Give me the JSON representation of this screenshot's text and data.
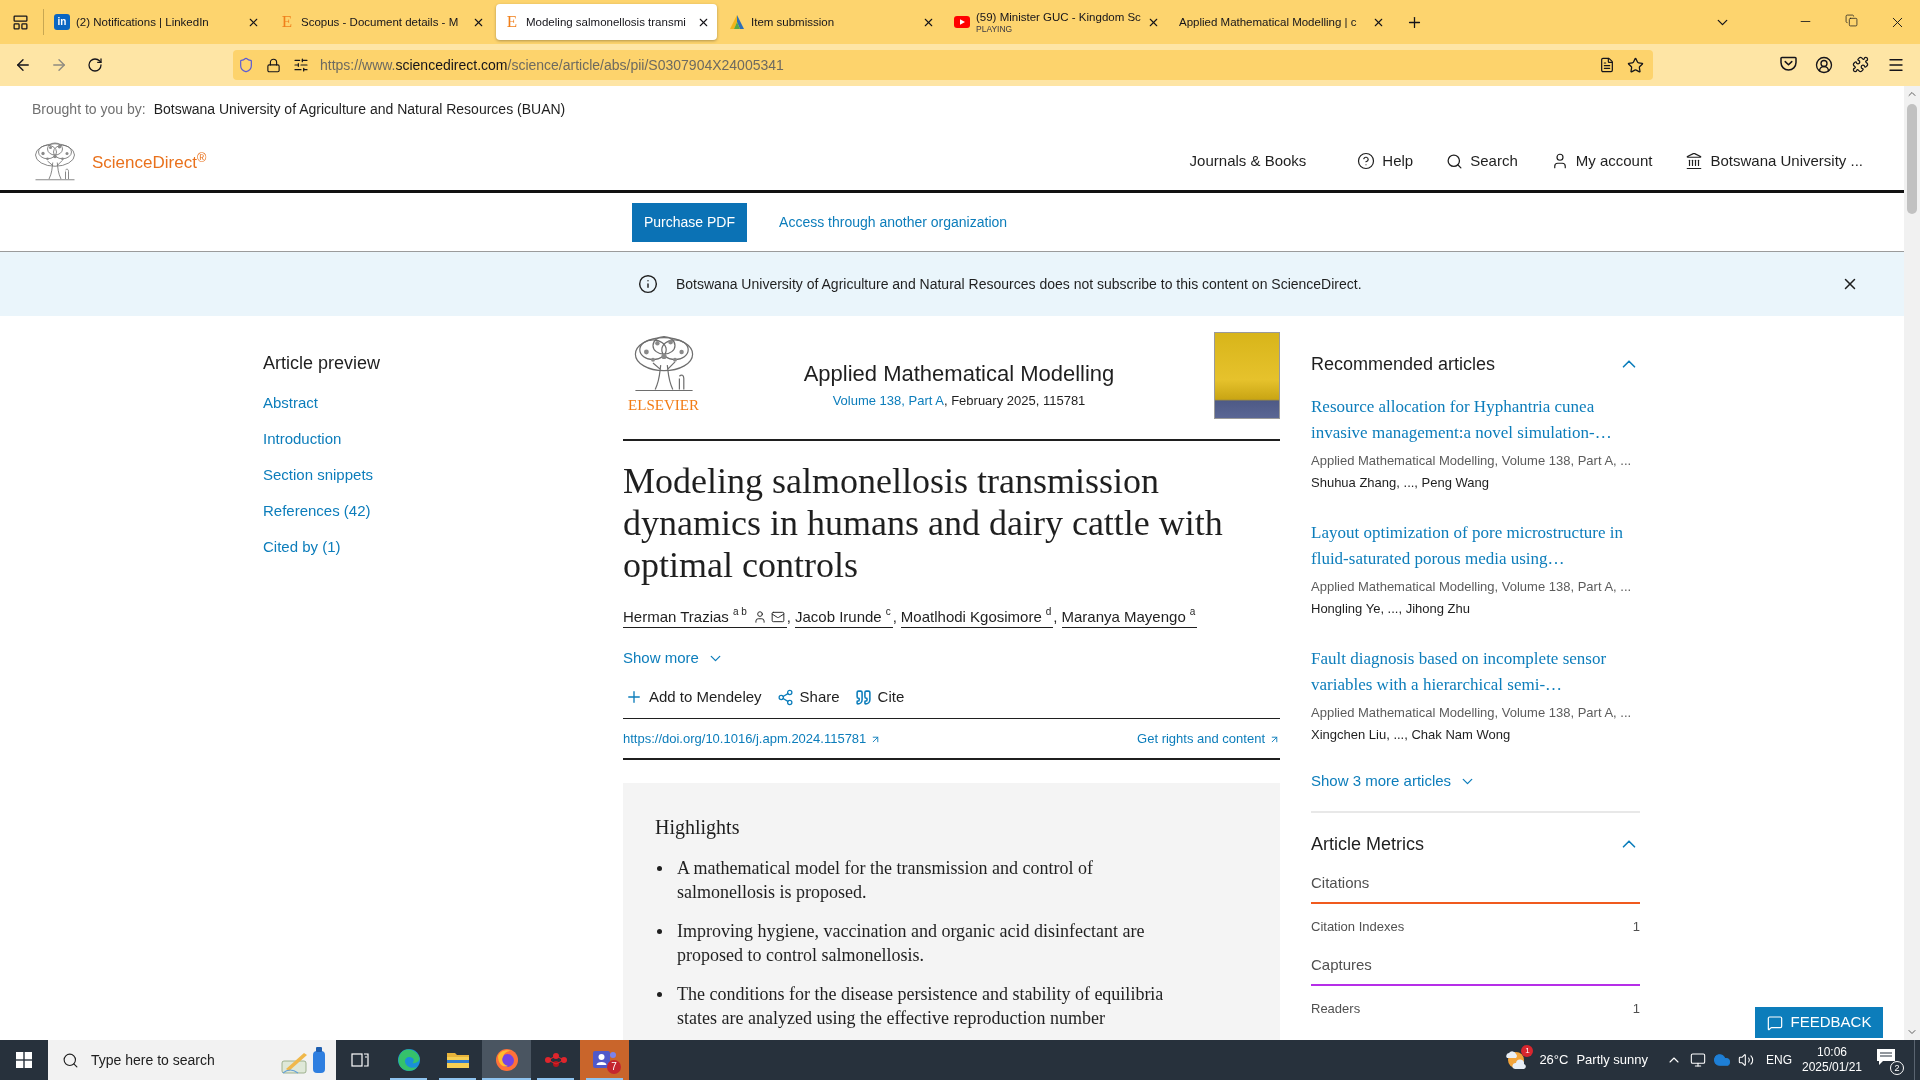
{
  "browser": {
    "tabs": [
      {
        "kind": "square",
        "glyph": "in",
        "title": "(2) Notifications | LinkedIn",
        "selected": false
      },
      {
        "kind": "letter",
        "glyph": "E",
        "title": "Scopus - Document details - M",
        "selected": false
      },
      {
        "kind": "letter",
        "glyph": "E",
        "title": "Modeling salmonellosis transmi",
        "selected": true
      },
      {
        "kind": "triangle",
        "title": "Item submission",
        "selected": false
      },
      {
        "kind": "play",
        "title": "(59) Minister GUC - Kingdom Sc",
        "subtitle": "PLAYING",
        "selected": false
      },
      {
        "kind": "plain",
        "title": "Applied Mathematical Modelling | c",
        "selected": false
      }
    ],
    "url": {
      "prefix": "https://www.",
      "domain": "sciencedirect.com",
      "path": "/science/article/abs/pii/S0307904X24005341"
    }
  },
  "page": {
    "access": {
      "label": "Brought to you by:",
      "institution": "Botswana University of Agriculture and Natural Resources (BUAN)"
    },
    "header": {
      "logo": "ScienceDirect$^{®}$",
      "nav": [
        {
          "kind": "plain",
          "label": "Journals & Books"
        },
        {
          "kind": "help",
          "label": "Help"
        },
        {
          "kind": "search",
          "label": "Search"
        },
        {
          "kind": "account",
          "label": "My account"
        },
        {
          "kind": "institution",
          "label": "Botswana University ..."
        }
      ]
    },
    "purchase": {
      "button": "Purchase PDF",
      "link": "Access through another organization"
    },
    "notice": {
      "text": "Botswana University of Agriculture and Natural Resources does not subscribe to this content on ScienceDirect."
    },
    "outline": {
      "title": "Article preview",
      "links": [
        "Abstract",
        "Introduction",
        "Section snippets",
        "References (42)",
        "Cited by (1)"
      ]
    },
    "journal": {
      "publisher": "ELSEVIER",
      "title": "Applied Mathematical Modelling",
      "volume": "Volume 138, Part A",
      "details": ", February 2025, 115781"
    },
    "article": {
      "title": "Modeling salmonellosis transmission dynamics in humans and dairy cattle with optimal controls",
      "authors": [
        {
          "name": "Herman Trazias",
          "affiliations": "a b",
          "corresponding": true
        },
        {
          "name": "Jacob Irunde",
          "affiliations": "c",
          "corresponding": false
        },
        {
          "name": "Moatlhodi Kgosimore",
          "affiliations": "d",
          "corresponding": false
        },
        {
          "name": "Maranya Mayengo",
          "affiliations": "a",
          "corresponding": false
        }
      ],
      "separator": ",",
      "show_more": "Show more",
      "actions": [
        {
          "kind": "add",
          "label": "Add to Mendeley"
        },
        {
          "kind": "share",
          "label": "Share"
        },
        {
          "kind": "cite",
          "label": "Cite"
        }
      ],
      "doi": "https://doi.org/10.1016/j.apm.2024.115781",
      "rights": "Get rights and content"
    },
    "highlights": {
      "title": "Highlights",
      "items": [
        "A mathematical model for the transmission and control of salmonellosis is proposed.",
        "Improving hygiene, vaccination and organic acid disinfectant are proposed to control salmonellosis.",
        "The conditions for the disease persistence and stability of equilibria states are analyzed using the effective reproduction number"
      ]
    },
    "recommended": {
      "title": "Recommended articles",
      "expanded": true,
      "articles": [
        {
          "title": "Resource allocation for Hyphantria cunea invasive management:a novel simulation-…",
          "source": "Applied Mathematical Modelling, Volume 138, Part A, ...",
          "authors": "Shuhua Zhang, ..., Peng Wang"
        },
        {
          "title": "Layout optimization of pore microstructure in fluid-saturated porous media using…",
          "source": "Applied Mathematical Modelling, Volume 138, Part A, ...",
          "authors": "Hongling Ye, ..., Jihong Zhu"
        },
        {
          "title": "Fault diagnosis based on incomplete sensor variables with a hierarchical semi-…",
          "source": "Applied Mathematical Modelling, Volume 138, Part A, ...",
          "authors": "Xingchen Liu, ..., Chak Nam Wong"
        }
      ],
      "show_more": "Show 3 more articles"
    },
    "metrics": {
      "title": "Article Metrics",
      "expanded": true,
      "groups": [
        {
          "name": "Citations",
          "color": "#f05a1e",
          "rows": [
            {
              "label": "Citation Indexes",
              "value": "1"
            }
          ]
        },
        {
          "name": "Captures",
          "color": "#b62ee8",
          "rows": [
            {
              "label": "Readers",
              "value": "1"
            }
          ]
        }
      ]
    },
    "feedback": "FEEDBACK"
  },
  "taskbar": {
    "search": {
      "placeholder": "Type here to search"
    },
    "apps": [
      {
        "kind": "edge",
        "running": true,
        "selected": false,
        "attention": false
      },
      {
        "kind": "folder",
        "running": true,
        "selected": false,
        "attention": false
      },
      {
        "kind": "firefox",
        "running": true,
        "selected": true,
        "attention": false
      },
      {
        "kind": "dots",
        "running": true,
        "selected": false,
        "attention": false
      },
      {
        "kind": "people",
        "running": true,
        "selected": false,
        "attention": true,
        "count": "7"
      }
    ],
    "weather": {
      "count": "1",
      "temperature": "26°C",
      "condition": "Partly sunny"
    },
    "language": "ENG",
    "time": "10:06",
    "date": "2025/01/21",
    "notifications": "2"
  }
}
